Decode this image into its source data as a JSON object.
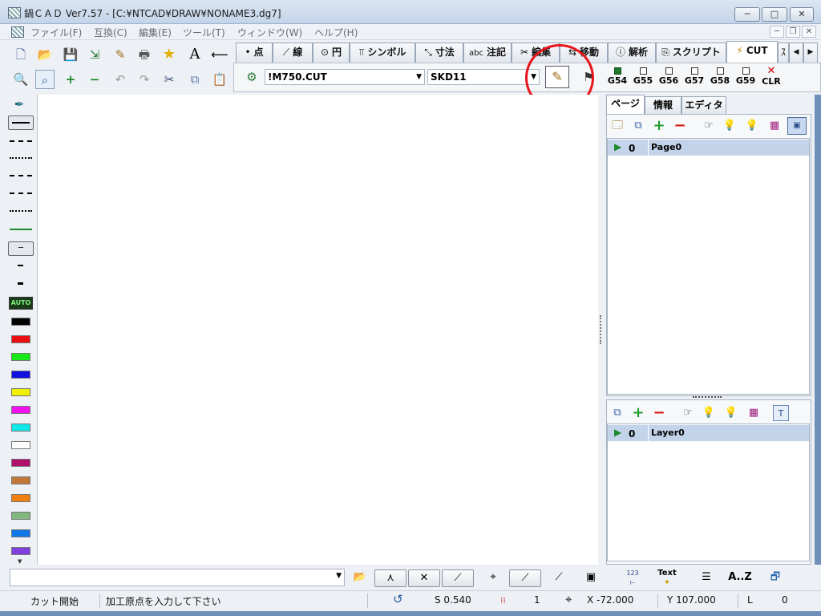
{
  "window": {
    "title": "鍋ＣＡＤ Ver7.57 - [C:¥NTCAD¥DRAW¥NONAME3.dg7]",
    "minimize": "─",
    "maximize": "□",
    "close": "✕"
  },
  "menu": {
    "items": [
      "ファイル(F)",
      "互換(C)",
      "編集(E)",
      "ツール(T)",
      "ウィンドウ(W)",
      "ヘルプ(H)"
    ],
    "mdi_min": "─",
    "mdi_restore": "❐",
    "mdi_close": "✕"
  },
  "toolbar": {
    "icons_row1": [
      "new-doc-icon",
      "open-folder-icon",
      "save-disk-icon",
      "import-icon",
      "tool-edit-icon",
      "print-icon",
      "star-icon",
      "text-a-icon",
      "back-arrow-icon"
    ],
    "glyphs_row1": [
      "🗋",
      "📂",
      "💾",
      "⇲",
      "✎",
      "🖶",
      "★",
      "A",
      "⟵"
    ],
    "glyphs_row2": [
      "🔍",
      "⌕",
      "+",
      "−",
      "↶",
      "↷",
      "✂",
      "⧉",
      "📋"
    ]
  },
  "tabs": [
    {
      "icon": "•",
      "label": "点"
    },
    {
      "icon": "⟋",
      "label": "線"
    },
    {
      "icon": "⊙",
      "label": "円"
    },
    {
      "icon": "⫪",
      "label": "シンボル"
    },
    {
      "icon": "⤡",
      "label": "寸法"
    },
    {
      "icon": "abc",
      "label": "注記"
    },
    {
      "icon": "✂",
      "label": "編集"
    },
    {
      "icon": "⇆",
      "label": "移動"
    },
    {
      "icon": "ⓘ",
      "label": "解析"
    },
    {
      "icon": "⎘",
      "label": "スクリプト"
    },
    {
      "icon": "⚡",
      "label": "CUT"
    },
    {
      "icon": "",
      "label": "ｽ"
    }
  ],
  "cut_bar": {
    "cut_file": "!M750.CUT",
    "material": "SKD11",
    "g_codes": [
      {
        "label": "G54",
        "active": true
      },
      {
        "label": "G55",
        "active": false
      },
      {
        "label": "G56",
        "active": false
      },
      {
        "label": "G57",
        "active": false
      },
      {
        "label": "G58",
        "active": false
      },
      {
        "label": "G59",
        "active": false
      }
    ],
    "clear_label": "CLR"
  },
  "palette": {
    "auto_label": "AUTO",
    "colors": [
      "#000000",
      "#e81010",
      "#18e818",
      "#1010e0",
      "#f0f000",
      "#f010f0",
      "#10e8e8",
      "#ffffff",
      "#b0106a",
      "#c07838",
      "#f08010",
      "#80b880",
      "#1078e8",
      "#8040e0"
    ]
  },
  "right_panel": {
    "tabs": [
      "ページ",
      "情報",
      "エディタ"
    ],
    "page_row": {
      "index": "0",
      "name": "Page0"
    },
    "layer_row": {
      "index": "0",
      "name": "Layer0"
    }
  },
  "bottom": {
    "command_value": "",
    "text_label": "Text",
    "sort_label": "A..Z",
    "num_label": "123"
  },
  "status": {
    "mode": "カット開始",
    "message": "加工原点を入力して下さい",
    "scale": "S 0.540",
    "grid": "1",
    "x": "X -72.000",
    "y": "Y 107.000",
    "layer_label": "L",
    "layer_value": "0"
  }
}
